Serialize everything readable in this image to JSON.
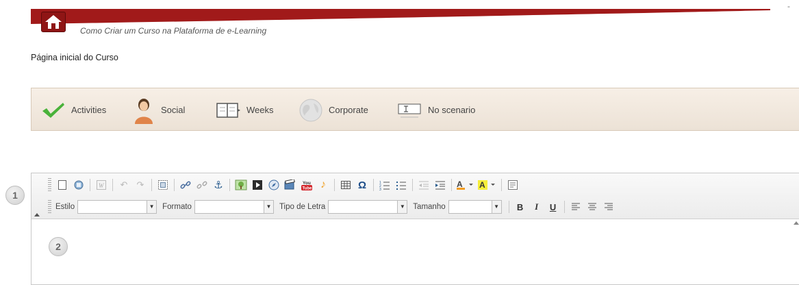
{
  "header": {
    "course_title": "Como Criar um Curso na Plataforma de e-Learning",
    "corner_mark": "-",
    "brand_color": "#a11a1a"
  },
  "page_title": "Página inicial do Curso",
  "scenarios": [
    {
      "label": "Activities",
      "icon": "check-icon"
    },
    {
      "label": "Social",
      "icon": "person-icon"
    },
    {
      "label": "Weeks",
      "icon": "book-icon"
    },
    {
      "label": "Corporate",
      "icon": "globe-icon"
    },
    {
      "label": "No scenario",
      "icon": "text-field-icon"
    }
  ],
  "markers": [
    "1",
    "2"
  ],
  "editor": {
    "style_label": "Estilo",
    "format_label": "Formato",
    "font_label": "Tipo de Letra",
    "size_label": "Tamanho",
    "style_value": "",
    "format_value": "",
    "font_value": "",
    "size_value": "",
    "bold": "B",
    "italic": "I",
    "underline": "U",
    "youtube_top": "You",
    "youtube_bottom": "Tube",
    "omega": "Ω",
    "text_color_letter": "A",
    "bg_color_letter": "A"
  }
}
